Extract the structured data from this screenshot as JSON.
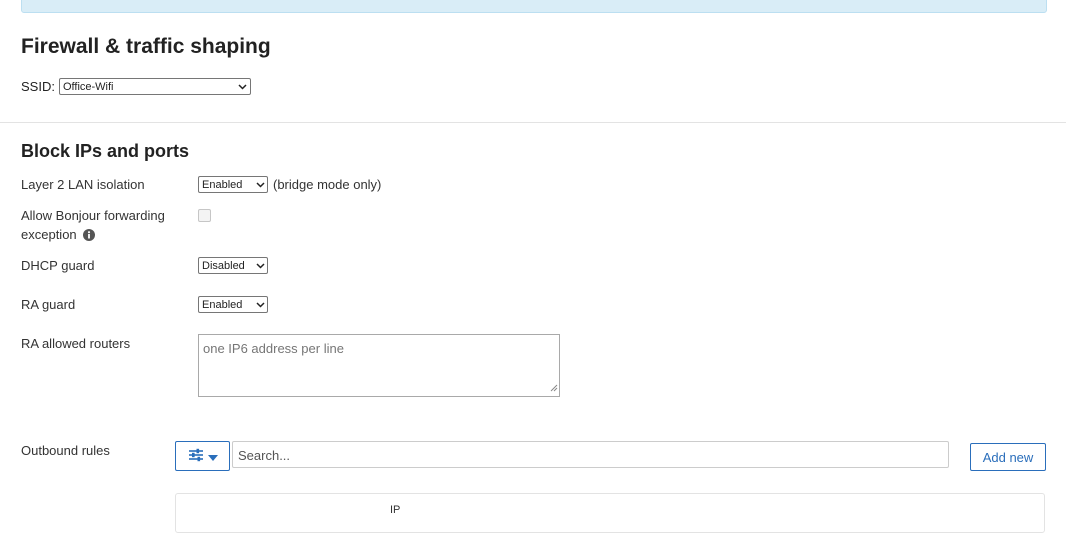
{
  "header": {
    "title": "Firewall & traffic shaping"
  },
  "ssid": {
    "label": "SSID:",
    "selected": "Office-Wifi"
  },
  "block_section": {
    "title": "Block IPs and ports",
    "lan_isolation": {
      "label": "Layer 2 LAN isolation",
      "selected": "Enabled",
      "note": "(bridge mode only)"
    },
    "bonjour": {
      "label_line1": "Allow Bonjour forwarding",
      "label_line2": "exception",
      "checked": false
    },
    "dhcp_guard": {
      "label": "DHCP guard",
      "selected": "Disabled"
    },
    "ra_guard": {
      "label": "RA guard",
      "selected": "Enabled"
    },
    "ra_routers": {
      "label": "RA allowed routers",
      "placeholder": "one IP6 address per line"
    }
  },
  "outbound": {
    "label": "Outbound rules",
    "search_placeholder": "Search...",
    "add_label": "Add new",
    "column_ip": "IP"
  },
  "colors": {
    "accent": "#2a6ebb",
    "banner": "#d9edf7"
  },
  "icons": [
    "info-icon",
    "sliders-icon",
    "caret-down-icon",
    "chevron-down-icon"
  ]
}
